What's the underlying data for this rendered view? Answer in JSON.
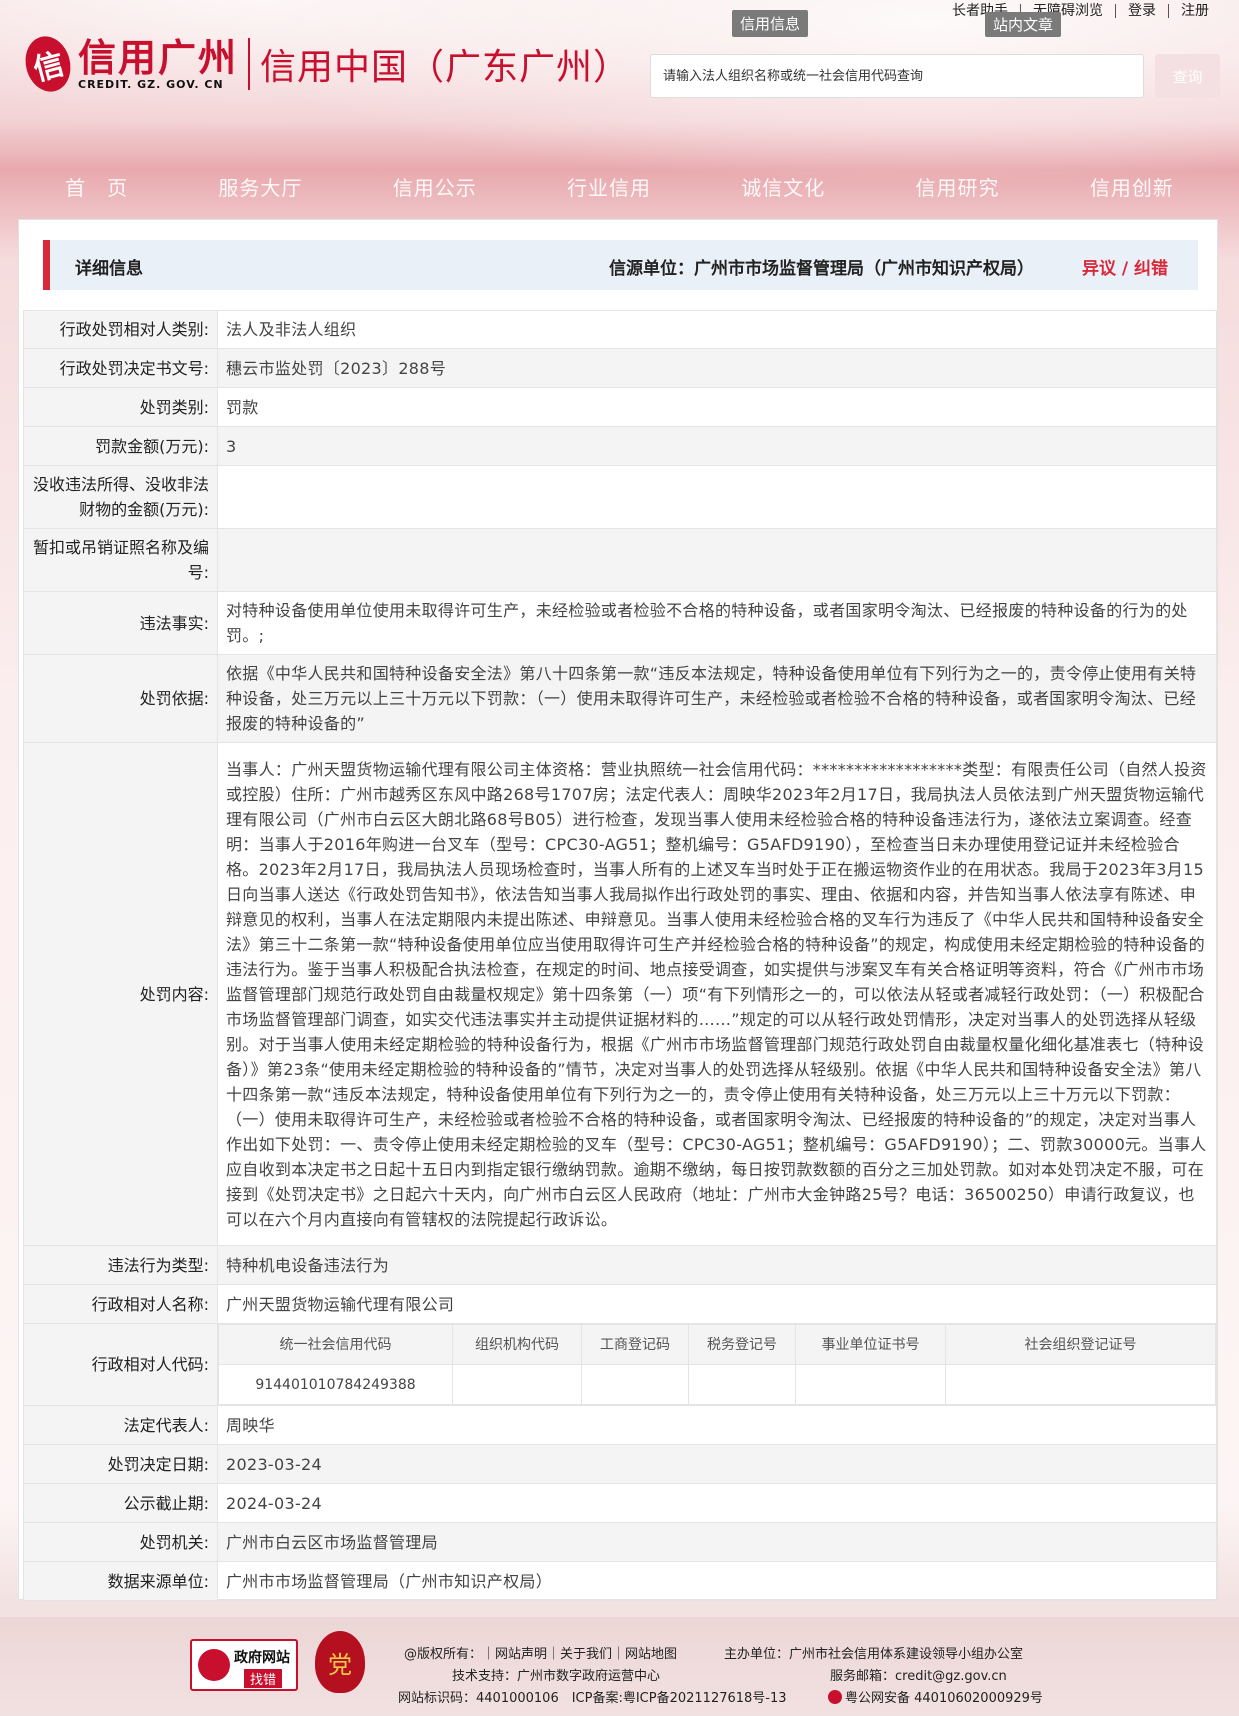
{
  "top_links": [
    "长者助手",
    "无障碍浏览",
    "登录",
    "注册"
  ],
  "tabs": {
    "xinyong": "信用信息",
    "zhannei": "站内文章"
  },
  "logo": {
    "mark": "信",
    "cn": "信用广州",
    "en": "CREDIT. GZ. GOV. CN",
    "cn2": "信用中国（广东广州）"
  },
  "search": {
    "placeholder": "请输入法人组织名称或统一社会信用代码查询",
    "button": "查询"
  },
  "nav": [
    "首　页",
    "服务大厅",
    "信用公示",
    "行业信用",
    "诚信文化",
    "信用研究",
    "信用创新"
  ],
  "header": {
    "title": "详细信息",
    "source": "信源单位：广州市市场监督管理局（广州市知识产权局）",
    "objection": "异议 / 纠错"
  },
  "rows": [
    {
      "label": "行政处罚相对人类别:",
      "value": "法人及非法人组织"
    },
    {
      "label": "行政处罚决定书文号:",
      "value": "穗云市监处罚〔2023〕288号"
    },
    {
      "label": "处罚类别:",
      "value": "罚款"
    },
    {
      "label": "罚款金额(万元):",
      "value": "3"
    },
    {
      "label": "没收违法所得、没收非法财物的金额(万元):",
      "value": ""
    },
    {
      "label": "暂扣或吊销证照名称及编号:",
      "value": ""
    },
    {
      "label": "违法事实:",
      "value": "对特种设备使用单位使用未取得许可生产，未经检验或者检验不合格的特种设备，或者国家明令淘汰、已经报废的特种设备的行为的处罚。;"
    },
    {
      "label": "处罚依据:",
      "value": "依据《中华人民共和国特种设备安全法》第八十四条第一款“违反本法规定，特种设备使用单位有下列行为之一的，责令停止使用有关特种设备，处三万元以上三十万元以下罚款：（一）使用未取得许可生产，未经检验或者检验不合格的特种设备，或者国家明令淘汰、已经报废的特种设备的”"
    },
    {
      "label": "处罚内容:",
      "value": "当事人：广州天盟货物运输代理有限公司主体资格：营业执照统一社会信用代码：******************类型：有限责任公司（自然人投资或控股）住所：广州市越秀区东风中路268号1707房；法定代表人：周映华2023年2月17日，我局执法人员依法到广州天盟货物运输代理有限公司（广州市白云区大朗北路68号B05）进行检查，发现当事人使用未经检验合格的特种设备违法行为，遂依法立案调查。经查明：当事人于2016年购进一台叉车（型号：CPC30-AG51；整机编号：G5AFD9190），至检查当日未办理使用登记证并未经检验合格。2023年2月17日，我局执法人员现场检查时，当事人所有的上述叉车当时处于正在搬运物资作业的在用状态。我局于2023年3月15日向当事人送达《行政处罚告知书》，依法告知当事人我局拟作出行政处罚的事实、理由、依据和内容，并告知当事人依法享有陈述、申辩意见的权利，当事人在法定期限内未提出陈述、申辩意见。当事人使用未经检验合格的叉车行为违反了《中华人民共和国特种设备安全法》第三十二条第一款“特种设备使用单位应当使用取得许可生产并经检验合格的特种设备”的规定，构成使用未经定期检验的特种设备的违法行为。鉴于当事人积极配合执法检查，在规定的时间、地点接受调查，如实提供与涉案叉车有关合格证明等资料，符合《广州市市场监督管理部门规范行政处罚自由裁量权规定》第十四条第（一）项“有下列情形之一的，可以依法从轻或者减轻行政处罚：（一）积极配合市场监督管理部门调查，如实交代违法事实并主动提供证据材料的……”规定的可以从轻行政处罚情形，决定对当事人的处罚选择从轻级别。对于当事人使用未经定期检验的特种设备行为，根据《广州市市场监督管理部门规范行政处罚自由裁量权量化细化基准表七（特种设备）》第23条“使用未经定期检验的特种设备的”情节，决定对当事人的处罚选择从轻级别。依据《中华人民共和国特种设备安全法》第八十四条第一款“违反本法规定，特种设备使用单位有下列行为之一的，责令停止使用有关特种设备，处三万元以上三十万元以下罚款：（一）使用未取得许可生产，未经检验或者检验不合格的特种设备，或者国家明令淘汰、已经报废的特种设备的”的规定，决定对当事人作出如下处罚：一、责令停止使用未经定期检验的叉车（型号：CPC30-AG51；整机编号：G5AFD9190）；二、罚款30000元。当事人应自收到本决定书之日起十五日内到指定银行缴纳罚款。逾期不缴纳，每日按罚款数额的百分之三加处罚款。如对本处罚决定不服，可在接到《处罚决定书》之日起六十天内，向广州市白云区人民政府（地址：广州市大金钟路25号？电话：36500250）申请行政复议，也可以在六个月内直接向有管辖权的法院提起行政诉讼。"
    },
    {
      "label": "违法行为类型:",
      "value": "特种机电设备违法行为"
    },
    {
      "label": "行政相对人名称:",
      "value": "广州天盟货物运输代理有限公司"
    }
  ],
  "code_row": {
    "label": "行政相对人代码:",
    "headers": [
      "统一社会信用代码",
      "组织机构代码",
      "工商登记码",
      "税务登记号",
      "事业单位证书号",
      "社会组织登记证号"
    ],
    "values": [
      "914401010784249388",
      "",
      "",
      "",
      "",
      ""
    ]
  },
  "rows2": [
    {
      "label": "法定代表人:",
      "value": "周映华"
    },
    {
      "label": "处罚决定日期:",
      "value": "2023-03-24"
    },
    {
      "label": "公示截止期:",
      "value": "2024-03-24"
    },
    {
      "label": "处罚机关:",
      "value": "广州市白云区市场监督管理局"
    },
    {
      "label": "数据来源单位:",
      "value": "广州市市场监督管理局（广州市知识产权局）"
    }
  ],
  "footer": {
    "badge_t1": "政府网站",
    "badge_t2": "找错",
    "party": "党",
    "line1a": "@版权所有：｜网站声明｜关于我们｜网站地图",
    "line1b": "主办单位：广州市社会信用体系建设领导小组办公室",
    "line2a": "技术支持：广州市数字政府运营中心",
    "line2b": "服务邮箱：credit@gz.gov.cn",
    "line3a": "网站标识码：4401000106　ICP备案:粤ICP备2021127618号-13",
    "line3b": "粤公网安备 44010602000929号"
  }
}
